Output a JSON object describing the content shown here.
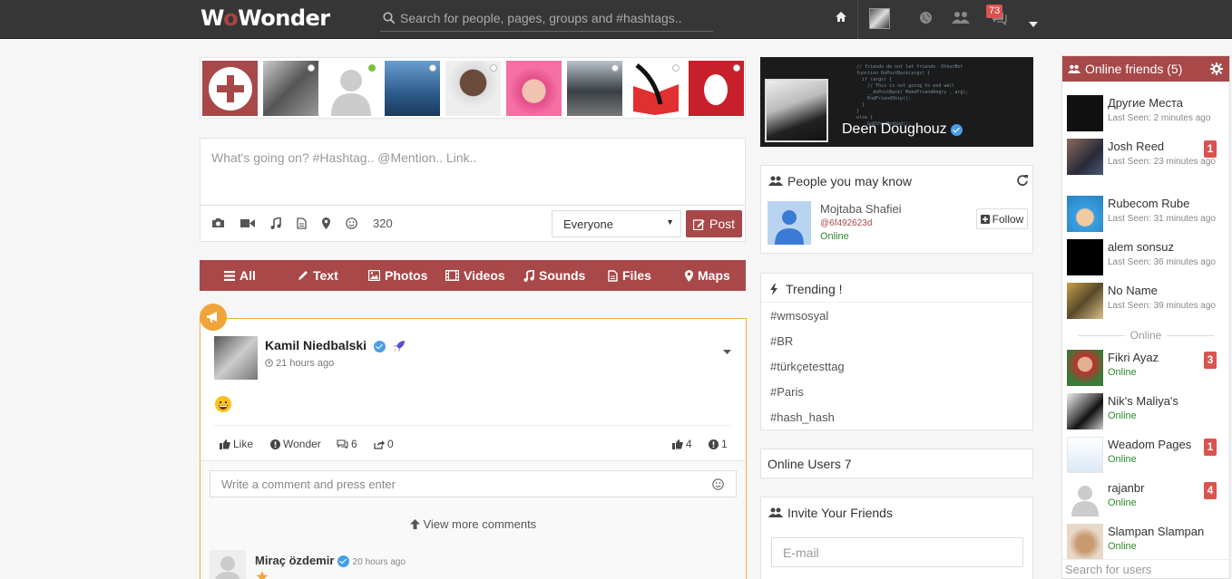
{
  "header": {
    "logo": "WoWonder",
    "search_placeholder": "Search for people, pages, groups and #hashtags..",
    "notification_count": "73"
  },
  "publisher": {
    "placeholder": "What's going on? #Hashtag.. @Mention.. Link..",
    "char_count": "320",
    "privacy": "Everyone",
    "post_label": "Post"
  },
  "filters": [
    {
      "label": "All",
      "icon": "list-icon"
    },
    {
      "label": "Text",
      "icon": "pencil-icon"
    },
    {
      "label": "Photos",
      "icon": "image-icon"
    },
    {
      "label": "Videos",
      "icon": "film-icon"
    },
    {
      "label": "Sounds",
      "icon": "music-icon"
    },
    {
      "label": "Files",
      "icon": "file-icon"
    },
    {
      "label": "Maps",
      "icon": "map-marker-icon"
    }
  ],
  "post": {
    "author": "Kamil Niedbalski",
    "time": "21 hours ago",
    "actions": {
      "like": "Like",
      "wonder": "Wonder",
      "comments": "6",
      "shares": "0",
      "likes_count": "4",
      "wonders_count": "1"
    },
    "comment_placeholder": "Write a comment and press enter",
    "view_more": "View more comments",
    "comment": {
      "author": "Miraç özdemir",
      "time": "20 hours ago"
    }
  },
  "profile_card": {
    "name": "Deen Doughouz"
  },
  "people_you_may_know": {
    "title": "People you may know",
    "person": {
      "name": "Mojtaba Shafiei",
      "handle": "@6f492623d",
      "status": "Online",
      "follow_label": "Follow"
    }
  },
  "trending": {
    "title": "Trending !",
    "tags": [
      "#wmsosyal",
      "#BR",
      "#türkçetesttag",
      "#Paris",
      "#hash_hash"
    ]
  },
  "online_users": {
    "label": "Online Users 7"
  },
  "invite": {
    "title": "Invite Your Friends",
    "email_placeholder": "E-mail"
  },
  "sidebar": {
    "title": "Online friends (5)",
    "separator": "Online",
    "search_placeholder": "Search for users",
    "recent": [
      {
        "name": "Другие Места",
        "seen": "Last Seen: 2 minutes ago",
        "badge": ""
      },
      {
        "name": "Josh Reed",
        "seen": "Last Seen: 23 minutes ago",
        "badge": "1"
      },
      {
        "name": "Rubecom Rube",
        "seen": "Last Seen: 31 minutes ago",
        "badge": ""
      },
      {
        "name": "alem sonsuz",
        "seen": "Last Seen: 36 minutes ago",
        "badge": ""
      },
      {
        "name": "No Name",
        "seen": "Last Seen: 39 minutes ago",
        "badge": ""
      }
    ],
    "online": [
      {
        "name": "Fikri Ayaz",
        "status": "Online",
        "badge": "3"
      },
      {
        "name": "Nik's Maliya's",
        "status": "Online",
        "badge": ""
      },
      {
        "name": "Weadom Pages",
        "status": "Online",
        "badge": "1"
      },
      {
        "name": "rajanbr",
        "status": "Online",
        "badge": "4"
      },
      {
        "name": "Slampan Slampan",
        "status": "Online",
        "badge": ""
      }
    ]
  }
}
